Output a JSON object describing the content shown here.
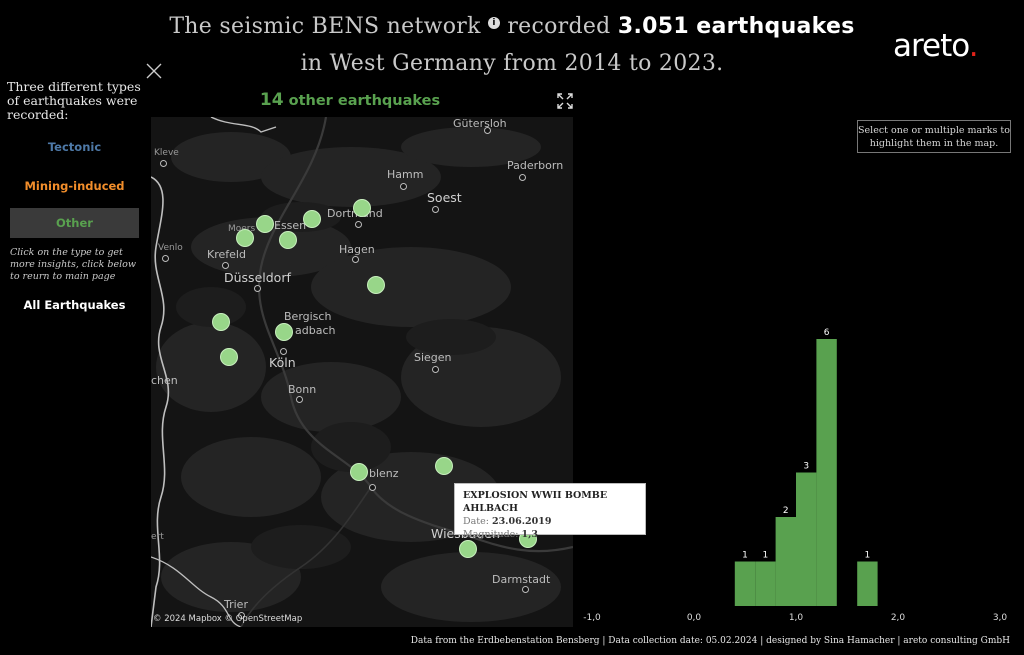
{
  "title": {
    "line1_part1": "The seismic BENS network",
    "info_icon": "i",
    "line1_part2": "recorded",
    "count": "3.051",
    "line1_part3": "earthquakes",
    "line2": "in West Germany from 2014 to 2023."
  },
  "logo": {
    "text": "areto",
    "dot": "."
  },
  "sidebar": {
    "intro": "Three different types of earthquakes were recorded:",
    "types": [
      {
        "label": "Tectonic",
        "color": "#4e79a7"
      },
      {
        "label": "Mining-induced",
        "color": "#f28e2b"
      },
      {
        "label": "Other",
        "color": "#59a14f",
        "selected": true
      }
    ],
    "hint": "Click on the type to get more insights, click below to reurn to main page",
    "all_label": "All Earthquakes"
  },
  "map": {
    "heading_count": "14",
    "heading_text": "other earthquakes",
    "attribution": "© 2024 Mapbox © OpenStreetMap",
    "cities": [
      {
        "name": "Gütersloh",
        "size": "mid"
      },
      {
        "name": "Paderborn",
        "size": "mid"
      },
      {
        "name": "Hamm",
        "size": "mid"
      },
      {
        "name": "Soest",
        "size": "big"
      },
      {
        "name": "Kleve",
        "size": "small"
      },
      {
        "name": "Moers",
        "size": "small"
      },
      {
        "name": "Essen",
        "size": "mid"
      },
      {
        "name": "Dortmund",
        "size": "mid"
      },
      {
        "name": "Venlo",
        "size": "small"
      },
      {
        "name": "Krefeld",
        "size": "mid"
      },
      {
        "name": "Hagen",
        "size": "mid"
      },
      {
        "name": "Düsseldorf",
        "size": "big"
      },
      {
        "name": "Bergisch",
        "size": "mid"
      },
      {
        "name": "adbach",
        "size": "mid"
      },
      {
        "name": "Siegen",
        "size": "mid"
      },
      {
        "name": "Köln",
        "size": "big"
      },
      {
        "name": "Bonn",
        "size": "mid"
      },
      {
        "name": "chen",
        "size": "mid"
      },
      {
        "name": "blenz",
        "size": "mid"
      },
      {
        "name": "Wiesbaden",
        "size": "big"
      },
      {
        "name": "Darmstadt",
        "size": "mid"
      },
      {
        "name": "Trier",
        "size": "mid"
      },
      {
        "name": "ert",
        "size": "small"
      }
    ]
  },
  "tooltip": {
    "title": "EXPLOSION WWII BOMBE AHLBACH",
    "date_label": "Date:",
    "date_value": "23.06.2019",
    "magnitude_label": "Magnitude:",
    "magnitude_value": "1,3"
  },
  "select_hint": "Select one or multiple marks to highlight them in the map.",
  "footer": "Data from the Erdbebenstation Bensberg | Data collection date: 05.02.2024 | designed by Sina Hamacher | areto consulting GmbH",
  "chart_data": {
    "type": "bar",
    "xlabel": "",
    "ylabel": "",
    "xlim": [
      -1.0,
      3.0
    ],
    "x_tick_labels": [
      "-1,0",
      "0,0",
      "1,0",
      "2,0",
      "3,0"
    ],
    "x_ticks": [
      -1.0,
      0.0,
      1.0,
      2.0,
      3.0
    ],
    "bin_width": 0.2,
    "bins": [
      {
        "start": 0.4,
        "end": 0.6,
        "value": 1
      },
      {
        "start": 0.6,
        "end": 0.8,
        "value": 1
      },
      {
        "start": 0.8,
        "end": 1.0,
        "value": 2
      },
      {
        "start": 1.0,
        "end": 1.2,
        "value": 3
      },
      {
        "start": 1.2,
        "end": 1.4,
        "value": 6
      },
      {
        "start": 1.6,
        "end": 1.8,
        "value": 1
      }
    ],
    "value_labels": [
      "1",
      "1",
      "2",
      "3",
      "6",
      "1"
    ],
    "bar_color": "#59a14f",
    "grid": false
  }
}
